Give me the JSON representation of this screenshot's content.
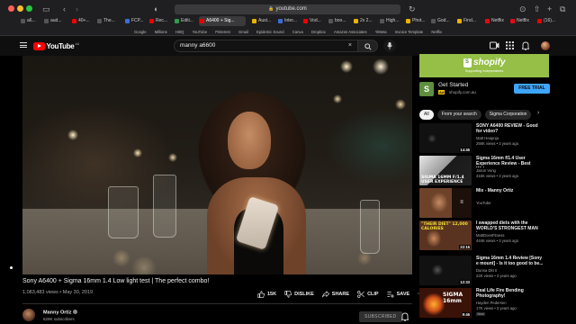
{
  "browser": {
    "url": "youtube.com",
    "tabs": [
      "a6...",
      "aud...",
      "40+...",
      "The...",
      "FCP...",
      "Rec...",
      "Editi...",
      "A6400 + Sig...",
      "Aust...",
      "Inter...",
      "Vod...",
      "boo...",
      "2x 2...",
      "High...",
      "Phot...",
      "God...",
      "Find...",
      "Netflix",
      "Netflix",
      "(16)..."
    ],
    "active_tab_index": 7,
    "bookmarks": [
      "Google",
      "Millions",
      "HitIQ",
      "YouTube",
      "Pinterest",
      "Gmail",
      "Epidemic Sound",
      "Canva",
      "Dropbox",
      "Amazon Associates",
      "YiMeta",
      "Invoice Template",
      "Netflix"
    ]
  },
  "header": {
    "logo_text": "YouTube",
    "region": "AU",
    "search_value": "manny a6600",
    "search_clear": "×"
  },
  "video": {
    "title": "Sony A6400 + Sigma 16mm 1.4 Low light test | The perfect combo!",
    "views": "1,083,483 views",
    "date": "May 30, 2019",
    "likes": "15K",
    "dislike_label": "DISLIKE",
    "share_label": "SHARE",
    "clip_label": "CLIP",
    "save_label": "SAVE",
    "more_label": "···",
    "channel": "Manny Ortiz",
    "subscribers": "629K subscribers",
    "subscribe_label": "SUBSCRIBED"
  },
  "ad": {
    "banner_brand": "shopify",
    "banner_tagline": "Supporting Independents",
    "title": "Get Started",
    "tag": "Ad",
    "url": "shopify.com.au",
    "cta": "FREE TRIAL"
  },
  "chips": [
    "All",
    "From your search",
    "Sigma Corporation"
  ],
  "recommendations": [
    {
      "title": "SONY A6400 REVIEW - Good for video?",
      "channel": "Matt Heapnja",
      "meta": "256K views • 3 years ago",
      "duration": "14:45"
    },
    {
      "title": "Sigma 16mm f/1.4 User Experience Review - Best Wide...",
      "channel": "Jason Vong",
      "meta": "416K views • 3 years ago",
      "duration": "",
      "thumb_text": "SIGMA 16MM F/1.4 USER EXPERIENCE"
    },
    {
      "title": "Mix - Manny Ortiz",
      "channel": "YouTube",
      "meta": "",
      "duration": ""
    },
    {
      "title": "I swapped diets with the WORLD'S STRONGEST MAN i...",
      "channel": "MattDoesFitness",
      "meta": "444K views • 3 years ago",
      "duration": "22:16",
      "thumb_text": "\"THEIR DIET\" 12,000 CALORIES"
    },
    {
      "title": "Sigma 16mm 1.4 Review [Sony e mount] - Is it too good to be...",
      "channel": "Dunna Dkt II",
      "meta": "22K views • 3 years ago",
      "duration": "12:33"
    },
    {
      "title": "Real Life Fire Bending Photography!",
      "channel": "Hayden Pedersen",
      "meta": "17K views • 3 years ago",
      "duration": "9:46",
      "badge": "New",
      "thumb_text": "SIGMA 16mm"
    }
  ],
  "colors": {
    "background": "#0f0f0f",
    "accent_red": "#ff0000",
    "shopify_green": "#95bf47",
    "cta_blue": "#3ea6ff"
  }
}
